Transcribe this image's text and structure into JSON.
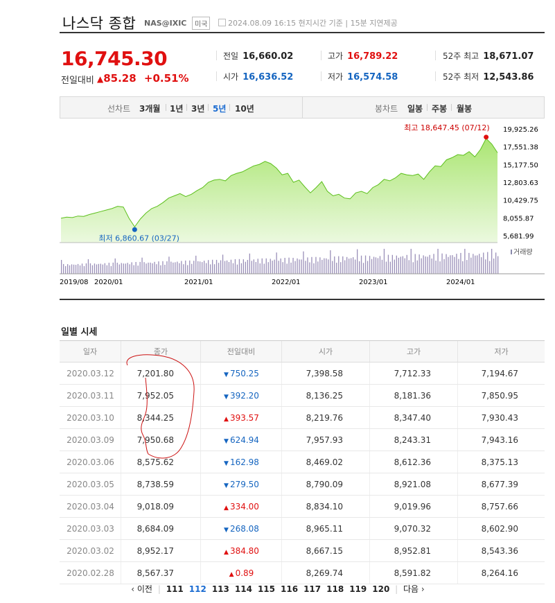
{
  "header": {
    "title": "나스닥 종합",
    "code": "NAS@IXIC",
    "market": "미국",
    "date_info": "2024.08.09 16:15 현지시간 기준  |  15분 지연제공"
  },
  "quote": {
    "price": "16,745.30",
    "change_label": "전일대비",
    "change_arrow": "▲",
    "change": "85.28",
    "change_pct": "+0.51%",
    "prev_label": "전일",
    "prev": "16,660.02",
    "open_label": "시가",
    "open": "16,636.52",
    "high_label": "고가",
    "high": "16,789.22",
    "low_label": "저가",
    "low": "16,574.58",
    "w52_high_label": "52주 최고",
    "w52_high": "18,671.07",
    "w52_low_label": "52주 최저",
    "w52_low": "12,543.86"
  },
  "period_bar": {
    "line_label": "선차트",
    "line_opts": [
      "3개월",
      "1년",
      "3년",
      "5년",
      "10년"
    ],
    "line_selected": "5년",
    "candle_label": "봉차트",
    "candle_opts": [
      "일봉",
      "주봉",
      "월봉"
    ]
  },
  "chart_data": {
    "type": "area",
    "y_ticks": [
      "19,925.26",
      "17,551.38",
      "15,177.50",
      "12,803.63",
      "10,429.75",
      "8,055.87",
      "5,681.99"
    ],
    "ylim": [
      5681.99,
      19925.26
    ],
    "x_ticks": [
      "2019/08",
      "2020/01",
      "2021/01",
      "2022/01",
      "2023/01",
      "2024/01"
    ],
    "high_label": "최고 18,647.45 (07/12)",
    "low_label": "최저 6,860.67 (03/27)",
    "volume_label": "거래량",
    "series": [
      {
        "values": [
          8000,
          8150,
          8100,
          8300,
          8250,
          8500,
          8700,
          8900,
          9100,
          9300,
          9600,
          9500,
          8000,
          6860,
          7900,
          8700,
          9300,
          9600,
          10100,
          10700,
          11000,
          11300,
          10900,
          11200,
          11700,
          12100,
          12800,
          13100,
          13200,
          13000,
          13700,
          14000,
          14200,
          14600,
          15000,
          15200,
          15600,
          15300,
          14700,
          13800,
          14000,
          12800,
          13100,
          12200,
          11400,
          12100,
          12900,
          11600,
          11000,
          11200,
          10700,
          10600,
          11400,
          11600,
          11300,
          12100,
          12500,
          13200,
          13000,
          13400,
          14000,
          13800,
          13700,
          13900,
          13200,
          14200,
          15000,
          14900,
          15800,
          16100,
          16500,
          16400,
          16900,
          16200,
          17200,
          18647,
          17900,
          16745
        ]
      }
    ]
  },
  "daily": {
    "title": "일별 시세",
    "headers": [
      "일자",
      "종가",
      "전일대비",
      "시가",
      "고가",
      "저가"
    ],
    "rows": [
      {
        "date": "2020.03.12",
        "close": "7,201.80",
        "dir": "down",
        "arrow": "▼",
        "chg": "750.25",
        "open": "7,398.58",
        "high": "7,712.33",
        "low": "7,194.67"
      },
      {
        "date": "2020.03.11",
        "close": "7,952.05",
        "dir": "down",
        "arrow": "▼",
        "chg": "392.20",
        "open": "8,136.25",
        "high": "8,181.36",
        "low": "7,850.95"
      },
      {
        "date": "2020.03.10",
        "close": "8,344.25",
        "dir": "up",
        "arrow": "▲",
        "chg": "393.57",
        "open": "8,219.76",
        "high": "8,347.40",
        "low": "7,930.43"
      },
      {
        "date": "2020.03.09",
        "close": "7,950.68",
        "dir": "down",
        "arrow": "▼",
        "chg": "624.94",
        "open": "7,957.93",
        "high": "8,243.31",
        "low": "7,943.16"
      },
      {
        "date": "2020.03.06",
        "close": "8,575.62",
        "dir": "down",
        "arrow": "▼",
        "chg": "162.98",
        "open": "8,469.02",
        "high": "8,612.36",
        "low": "8,375.13"
      },
      {
        "date": "2020.03.05",
        "close": "8,738.59",
        "dir": "down",
        "arrow": "▼",
        "chg": "279.50",
        "open": "8,790.09",
        "high": "8,921.08",
        "low": "8,677.39"
      },
      {
        "date": "2020.03.04",
        "close": "9,018.09",
        "dir": "up",
        "arrow": "▲",
        "chg": "334.00",
        "open": "8,834.10",
        "high": "9,019.96",
        "low": "8,757.66"
      },
      {
        "date": "2020.03.03",
        "close": "8,684.09",
        "dir": "down",
        "arrow": "▼",
        "chg": "268.08",
        "open": "8,965.11",
        "high": "9,070.32",
        "low": "8,602.90"
      },
      {
        "date": "2020.03.02",
        "close": "8,952.17",
        "dir": "up",
        "arrow": "▲",
        "chg": "384.80",
        "open": "8,667.15",
        "high": "8,952.81",
        "low": "8,543.36"
      },
      {
        "date": "2020.02.28",
        "close": "8,567.37",
        "dir": "up",
        "arrow": "▲",
        "chg": "0.89",
        "open": "8,269.74",
        "high": "8,591.82",
        "low": "8,264.16"
      }
    ]
  },
  "pager": {
    "prev": "이전",
    "next": "다음",
    "pages": [
      "111",
      "112",
      "113",
      "114",
      "115",
      "116",
      "117",
      "118",
      "119",
      "120"
    ],
    "current": "112"
  }
}
